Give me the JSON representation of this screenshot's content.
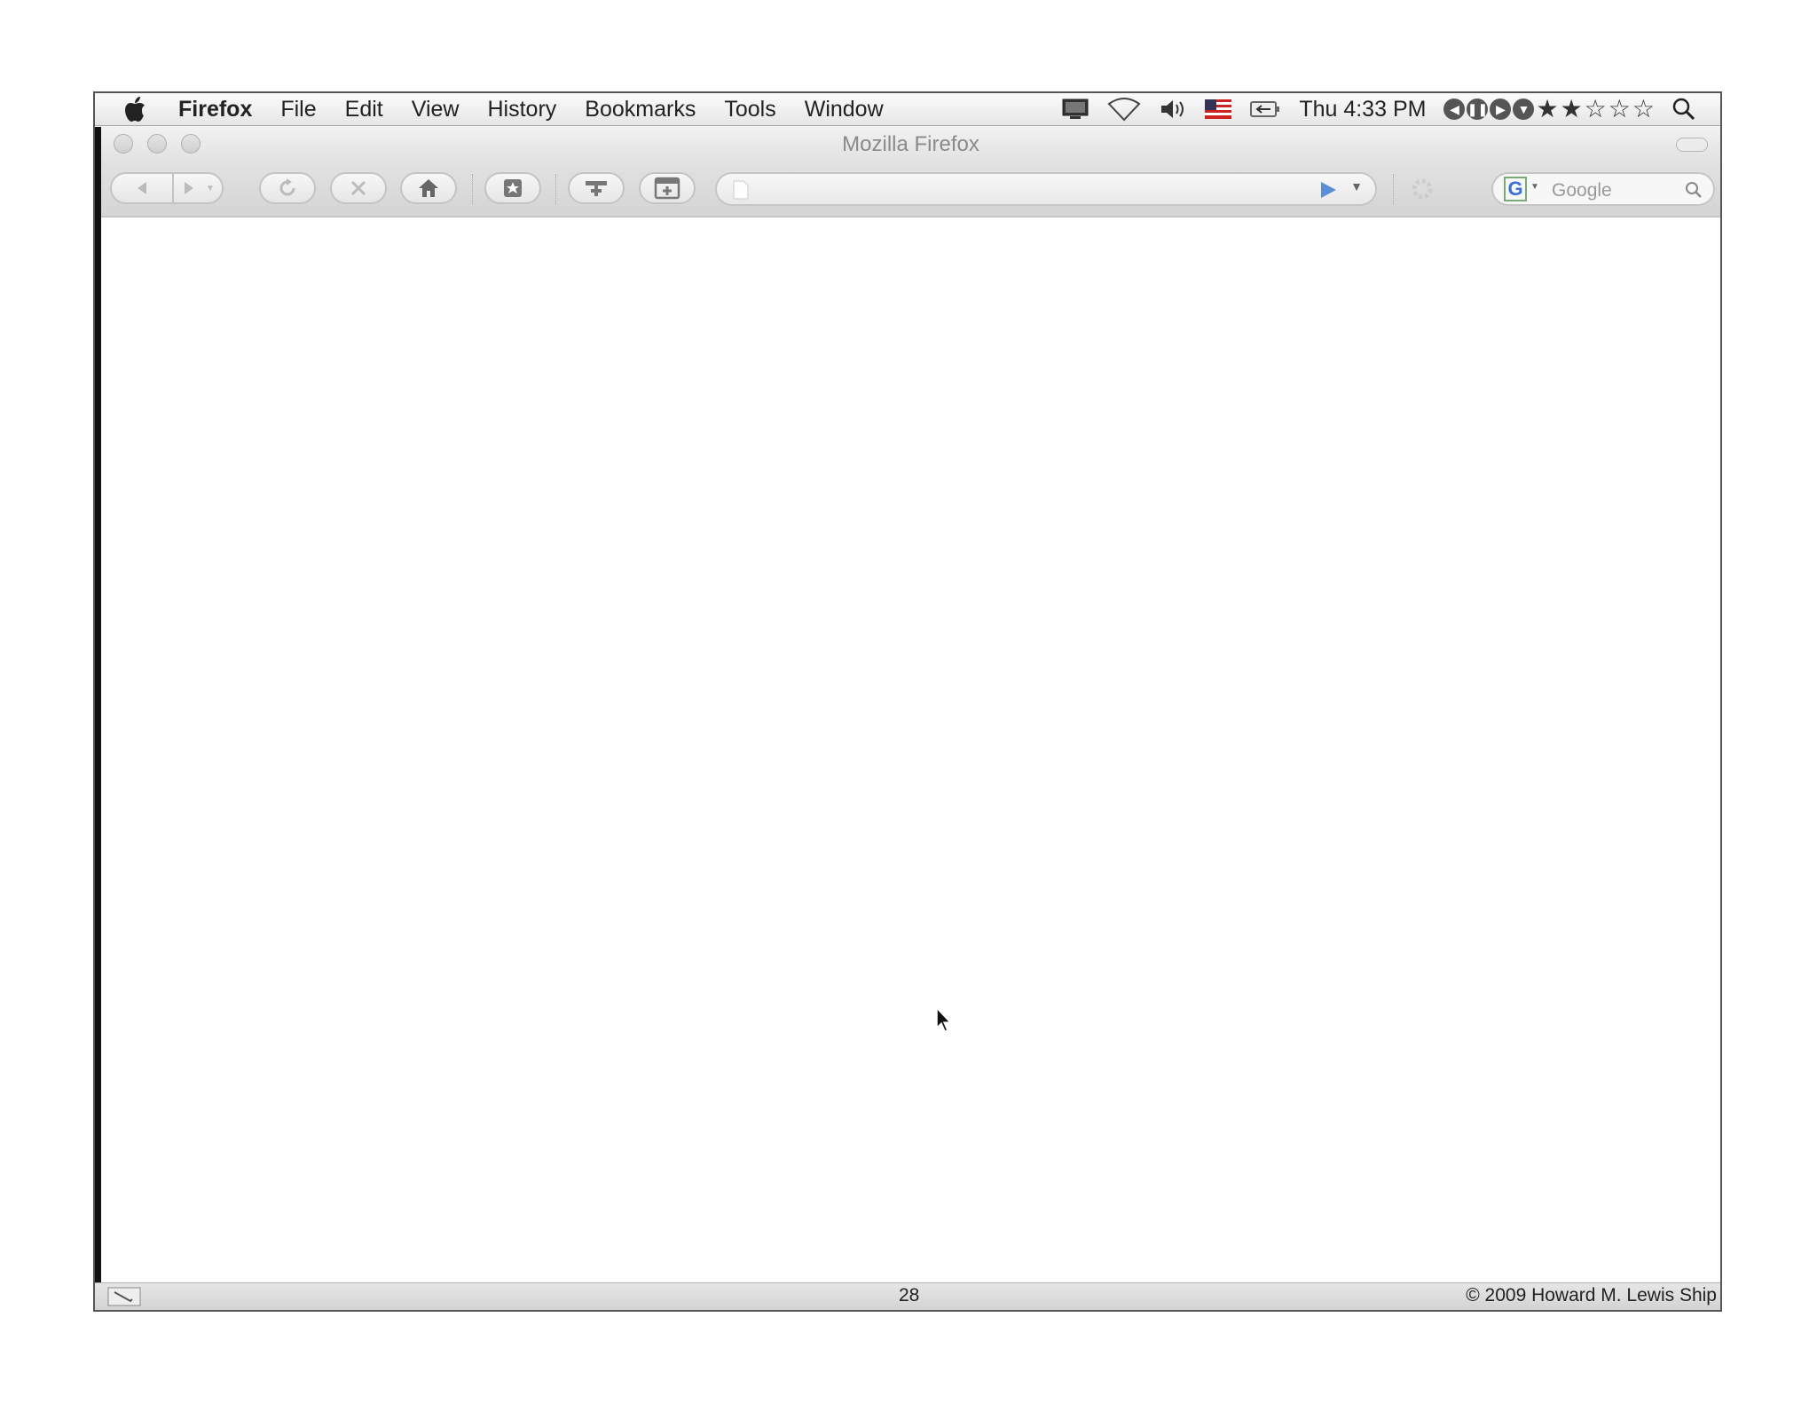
{
  "menubar": {
    "apple": "apple-logo-icon",
    "app_name": "Firefox",
    "items": [
      "File",
      "Edit",
      "View",
      "History",
      "Bookmarks",
      "Tools",
      "Window"
    ],
    "clock": "Thu 4:33 PM",
    "status_icons": [
      "display-icon",
      "wifi-icon",
      "volume-icon",
      "us-flag-icon",
      "battery-icon"
    ],
    "media_controls": [
      "previous-icon",
      "pause-icon",
      "next-icon",
      "menu-icon"
    ],
    "rating": {
      "filled": 2,
      "total": 5
    },
    "spotlight": "search-icon"
  },
  "window": {
    "title": "Mozilla Firefox"
  },
  "toolbar": {
    "buttons": [
      "back",
      "forward",
      "history-dropdown",
      "reload",
      "stop",
      "home",
      "bookmarks",
      "add-bookmark",
      "new-tab"
    ],
    "url_value": "",
    "go_icon": "go-arrow-icon",
    "search_engine": "Google",
    "search_placeholder": "Google"
  },
  "statusbar": {
    "page_number": "28",
    "copyright": "© 2009 Howard M. Lewis Ship"
  }
}
